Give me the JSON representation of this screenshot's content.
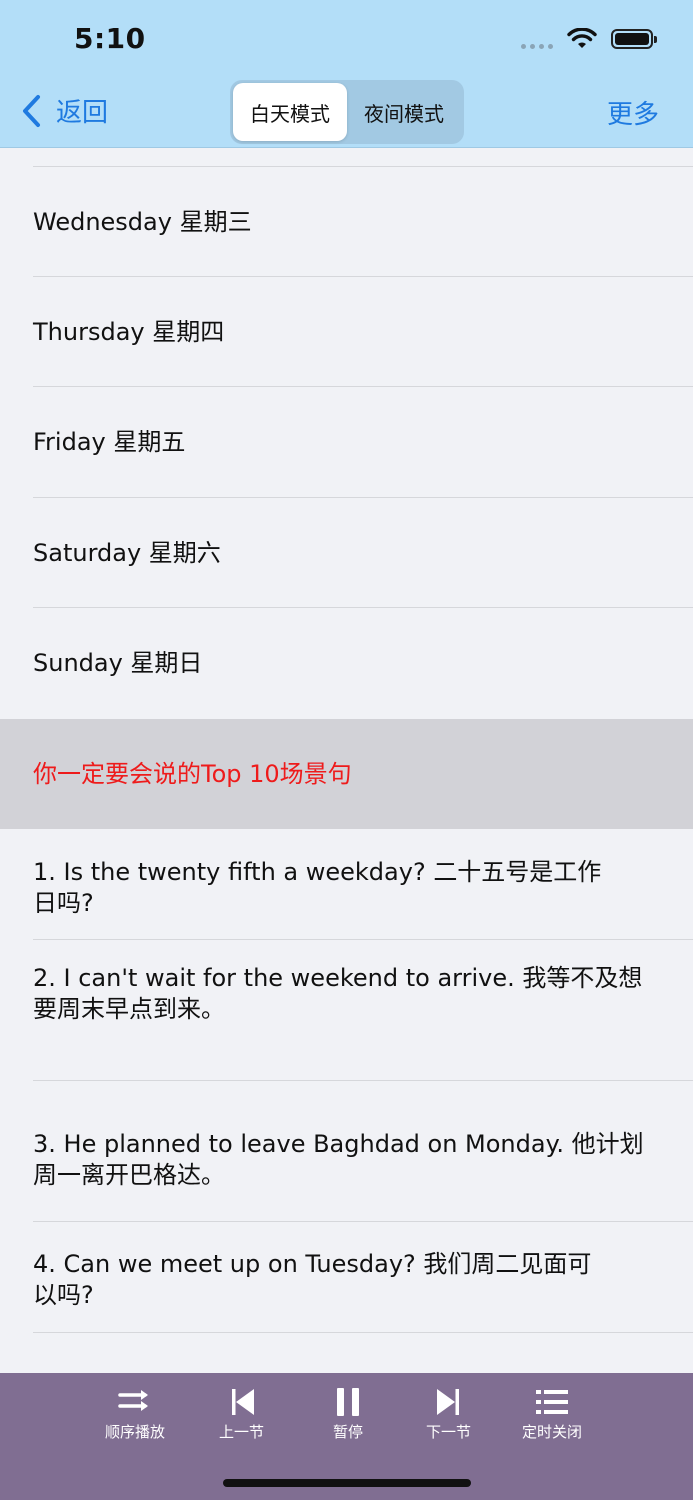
{
  "status_bar": {
    "time": "5:10"
  },
  "nav": {
    "back_label": "返回",
    "segments": [
      "白天模式",
      "夜间模式"
    ],
    "active_segment": 0,
    "more_label": "更多"
  },
  "list": {
    "days": [
      "Wednesday 星期三",
      "Thursday 星期四",
      "Friday 星期五",
      "Saturday 星期六",
      "Sunday 星期日"
    ],
    "section_title": "你一定要会说的Top 10场景句",
    "sentences": [
      "1. Is the twenty fifth a weekday? 二十五号是工作日吗?",
      "2. I can't wait for the weekend to arrive. 我等不及想要周末早点到来。",
      "3. He planned to leave Baghdad on Monday. 他计划周一离开巴格达。",
      "4. Can we meet up on Tuesday? 我们周二见面可以吗?"
    ]
  },
  "player": {
    "controls": [
      {
        "label": "顺序播放",
        "icon": "shuffle-arrows-icon"
      },
      {
        "label": "上一节",
        "icon": "previous-track-icon"
      },
      {
        "label": "暂停",
        "icon": "pause-icon"
      },
      {
        "label": "下一节",
        "icon": "next-track-icon"
      },
      {
        "label": "定时关闭",
        "icon": "list-timer-icon"
      }
    ]
  },
  "colors": {
    "header_bg": "#b3def8",
    "accent": "#1f7ae0",
    "section_text": "#ee1b1b",
    "player_bg": "#806e92"
  }
}
